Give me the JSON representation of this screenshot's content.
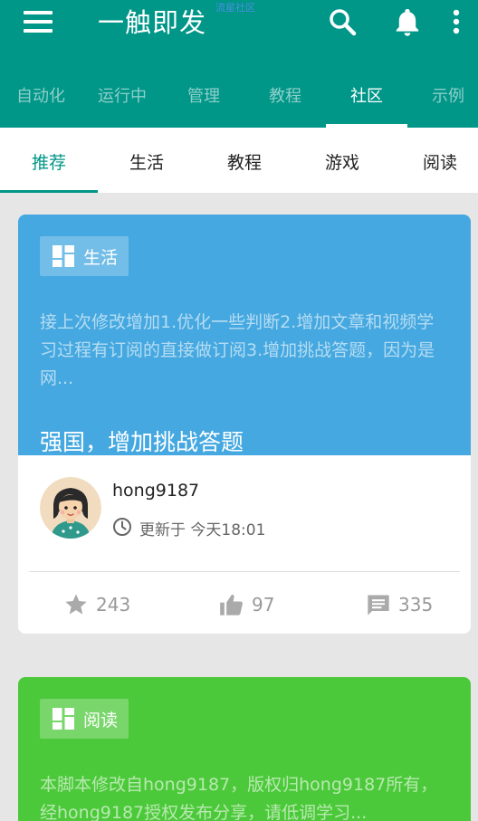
{
  "header": {
    "title": "一触即发",
    "subtitle": "流星社区"
  },
  "top_tabs": [
    "自动化",
    "运行中",
    "管理",
    "教程",
    "社区",
    "示例"
  ],
  "top_tabs_active": "社区",
  "sub_tabs": [
    "推荐",
    "生活",
    "教程",
    "游戏",
    "阅读"
  ],
  "sub_tabs_active": "推荐",
  "cards": [
    {
      "category": "生活",
      "excerpt": "接上次修改增加1.优化一些判断2.增加文章和视频学习过程有订阅的直接做订阅3.增加挑战答题，因为是网...",
      "title": "强国，增加挑战答题",
      "author": "hong9187",
      "updated": "更新于 今天18:01",
      "stars": "243",
      "likes": "97",
      "comments": "335",
      "color": "#45a8e0"
    },
    {
      "category": "阅读",
      "excerpt": "本脚本修改自hong9187，版权归hong9187所有，经hong9187授权发布分享，请低调学习...",
      "color": "#4cc93a"
    }
  ],
  "colors": {
    "primary": "#009688",
    "accent_indicator": "#ffffff"
  }
}
